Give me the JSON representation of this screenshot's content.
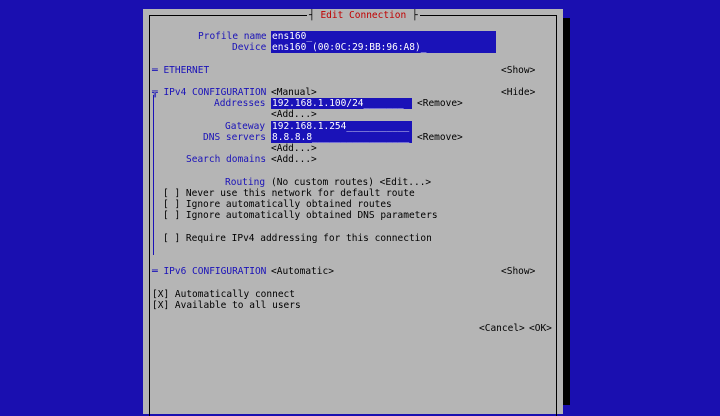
{
  "title": "Edit Connection",
  "profile_name": {
    "label": "Profile name",
    "value": "ens160_"
  },
  "device": {
    "label": "Device",
    "value": "ens160 (00:0C:29:BB:96:A8)_"
  },
  "ethernet": {
    "header": "═ ETHERNET",
    "toggle": "<Show>"
  },
  "ipv4": {
    "header": "╦ IPv4 CONFIGURATION",
    "mode": "<Manual>",
    "toggle": "<Hide>",
    "addresses_label": "Addresses",
    "address_value": "192.168.1.100/24_______",
    "remove_label": "<Remove>",
    "add_label": "<Add...>",
    "gateway_label": "Gateway",
    "gateway_value": "192.168.1.254___________",
    "dns_label": "DNS servers",
    "dns_value": "8.8.8.8_________________",
    "search_label": "Search domains",
    "routing_label": "Routing",
    "routing_value": "(No custom routes) <Edit...>",
    "opt_never_default": "[ ] Never use this network for default route",
    "opt_ignore_routes": "[ ] Ignore automatically obtained routes",
    "opt_ignore_dns": "[ ] Ignore automatically obtained DNS parameters",
    "opt_require": "[ ] Require IPv4 addressing for this connection"
  },
  "ipv6": {
    "header": "═ IPv6 CONFIGURATION",
    "mode": "<Automatic>",
    "toggle": "<Show>"
  },
  "auto_connect": "[X] Automatically connect",
  "all_users": "[X] Available to all users",
  "cancel": "<Cancel>",
  "ok": "<OK>"
}
